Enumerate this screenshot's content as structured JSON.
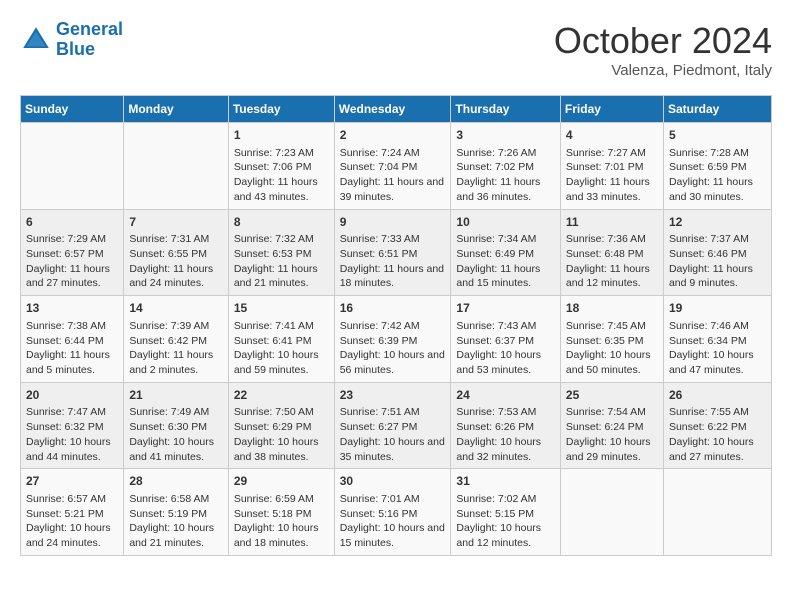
{
  "header": {
    "logo_line1": "General",
    "logo_line2": "Blue",
    "month": "October 2024",
    "location": "Valenza, Piedmont, Italy"
  },
  "days_of_week": [
    "Sunday",
    "Monday",
    "Tuesday",
    "Wednesday",
    "Thursday",
    "Friday",
    "Saturday"
  ],
  "weeks": [
    [
      {
        "day": "",
        "content": ""
      },
      {
        "day": "",
        "content": ""
      },
      {
        "day": "1",
        "content": "Sunrise: 7:23 AM\nSunset: 7:06 PM\nDaylight: 11 hours and 43 minutes."
      },
      {
        "day": "2",
        "content": "Sunrise: 7:24 AM\nSunset: 7:04 PM\nDaylight: 11 hours and 39 minutes."
      },
      {
        "day": "3",
        "content": "Sunrise: 7:26 AM\nSunset: 7:02 PM\nDaylight: 11 hours and 36 minutes."
      },
      {
        "day": "4",
        "content": "Sunrise: 7:27 AM\nSunset: 7:01 PM\nDaylight: 11 hours and 33 minutes."
      },
      {
        "day": "5",
        "content": "Sunrise: 7:28 AM\nSunset: 6:59 PM\nDaylight: 11 hours and 30 minutes."
      }
    ],
    [
      {
        "day": "6",
        "content": "Sunrise: 7:29 AM\nSunset: 6:57 PM\nDaylight: 11 hours and 27 minutes."
      },
      {
        "day": "7",
        "content": "Sunrise: 7:31 AM\nSunset: 6:55 PM\nDaylight: 11 hours and 24 minutes."
      },
      {
        "day": "8",
        "content": "Sunrise: 7:32 AM\nSunset: 6:53 PM\nDaylight: 11 hours and 21 minutes."
      },
      {
        "day": "9",
        "content": "Sunrise: 7:33 AM\nSunset: 6:51 PM\nDaylight: 11 hours and 18 minutes."
      },
      {
        "day": "10",
        "content": "Sunrise: 7:34 AM\nSunset: 6:49 PM\nDaylight: 11 hours and 15 minutes."
      },
      {
        "day": "11",
        "content": "Sunrise: 7:36 AM\nSunset: 6:48 PM\nDaylight: 11 hours and 12 minutes."
      },
      {
        "day": "12",
        "content": "Sunrise: 7:37 AM\nSunset: 6:46 PM\nDaylight: 11 hours and 9 minutes."
      }
    ],
    [
      {
        "day": "13",
        "content": "Sunrise: 7:38 AM\nSunset: 6:44 PM\nDaylight: 11 hours and 5 minutes."
      },
      {
        "day": "14",
        "content": "Sunrise: 7:39 AM\nSunset: 6:42 PM\nDaylight: 11 hours and 2 minutes."
      },
      {
        "day": "15",
        "content": "Sunrise: 7:41 AM\nSunset: 6:41 PM\nDaylight: 10 hours and 59 minutes."
      },
      {
        "day": "16",
        "content": "Sunrise: 7:42 AM\nSunset: 6:39 PM\nDaylight: 10 hours and 56 minutes."
      },
      {
        "day": "17",
        "content": "Sunrise: 7:43 AM\nSunset: 6:37 PM\nDaylight: 10 hours and 53 minutes."
      },
      {
        "day": "18",
        "content": "Sunrise: 7:45 AM\nSunset: 6:35 PM\nDaylight: 10 hours and 50 minutes."
      },
      {
        "day": "19",
        "content": "Sunrise: 7:46 AM\nSunset: 6:34 PM\nDaylight: 10 hours and 47 minutes."
      }
    ],
    [
      {
        "day": "20",
        "content": "Sunrise: 7:47 AM\nSunset: 6:32 PM\nDaylight: 10 hours and 44 minutes."
      },
      {
        "day": "21",
        "content": "Sunrise: 7:49 AM\nSunset: 6:30 PM\nDaylight: 10 hours and 41 minutes."
      },
      {
        "day": "22",
        "content": "Sunrise: 7:50 AM\nSunset: 6:29 PM\nDaylight: 10 hours and 38 minutes."
      },
      {
        "day": "23",
        "content": "Sunrise: 7:51 AM\nSunset: 6:27 PM\nDaylight: 10 hours and 35 minutes."
      },
      {
        "day": "24",
        "content": "Sunrise: 7:53 AM\nSunset: 6:26 PM\nDaylight: 10 hours and 32 minutes."
      },
      {
        "day": "25",
        "content": "Sunrise: 7:54 AM\nSunset: 6:24 PM\nDaylight: 10 hours and 29 minutes."
      },
      {
        "day": "26",
        "content": "Sunrise: 7:55 AM\nSunset: 6:22 PM\nDaylight: 10 hours and 27 minutes."
      }
    ],
    [
      {
        "day": "27",
        "content": "Sunrise: 6:57 AM\nSunset: 5:21 PM\nDaylight: 10 hours and 24 minutes."
      },
      {
        "day": "28",
        "content": "Sunrise: 6:58 AM\nSunset: 5:19 PM\nDaylight: 10 hours and 21 minutes."
      },
      {
        "day": "29",
        "content": "Sunrise: 6:59 AM\nSunset: 5:18 PM\nDaylight: 10 hours and 18 minutes."
      },
      {
        "day": "30",
        "content": "Sunrise: 7:01 AM\nSunset: 5:16 PM\nDaylight: 10 hours and 15 minutes."
      },
      {
        "day": "31",
        "content": "Sunrise: 7:02 AM\nSunset: 5:15 PM\nDaylight: 10 hours and 12 minutes."
      },
      {
        "day": "",
        "content": ""
      },
      {
        "day": "",
        "content": ""
      }
    ]
  ]
}
